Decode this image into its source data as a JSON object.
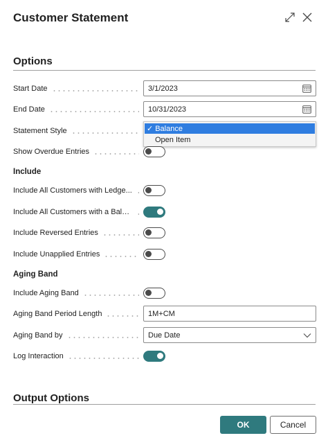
{
  "dialog": {
    "title": "Customer Statement"
  },
  "sections": {
    "options": "Options",
    "output_options": "Output Options"
  },
  "groups": {
    "include": "Include",
    "aging_band": "Aging Band"
  },
  "fields": {
    "start_date": {
      "label": "Start Date",
      "value": "3/1/2023"
    },
    "end_date": {
      "label": "End Date",
      "value": "10/31/2023"
    },
    "statement_style": {
      "label": "Statement Style",
      "options": [
        "Balance",
        "Open Item"
      ],
      "selected": "Balance",
      "check": "✓"
    },
    "show_overdue": {
      "label": "Show Overdue Entries",
      "on": false
    },
    "include_all_ledger": {
      "label": "Include All Customers with Ledge...",
      "on": false
    },
    "include_all_balance": {
      "label": "Include All Customers with a Bala...",
      "on": true
    },
    "include_reversed": {
      "label": "Include Reversed Entries",
      "on": false
    },
    "include_unapplied": {
      "label": "Include Unapplied Entries",
      "on": false
    },
    "include_aging": {
      "label": "Include Aging Band",
      "on": false
    },
    "aging_period_length": {
      "label": "Aging Band Period Length",
      "value": "1M+CM"
    },
    "aging_band_by": {
      "label": "Aging Band by",
      "value": "Due Date"
    },
    "log_interaction": {
      "label": "Log Interaction",
      "on": true
    }
  },
  "buttons": {
    "ok": "OK",
    "cancel": "Cancel"
  },
  "colors": {
    "accent": "#2f7a7e",
    "dropdown_highlight": "#2f7de0"
  },
  "icons": {
    "expand": "expand-icon",
    "close": "close-icon",
    "calendar": "calendar-icon",
    "chevron": "chevron-down-icon",
    "check": "check-icon"
  }
}
